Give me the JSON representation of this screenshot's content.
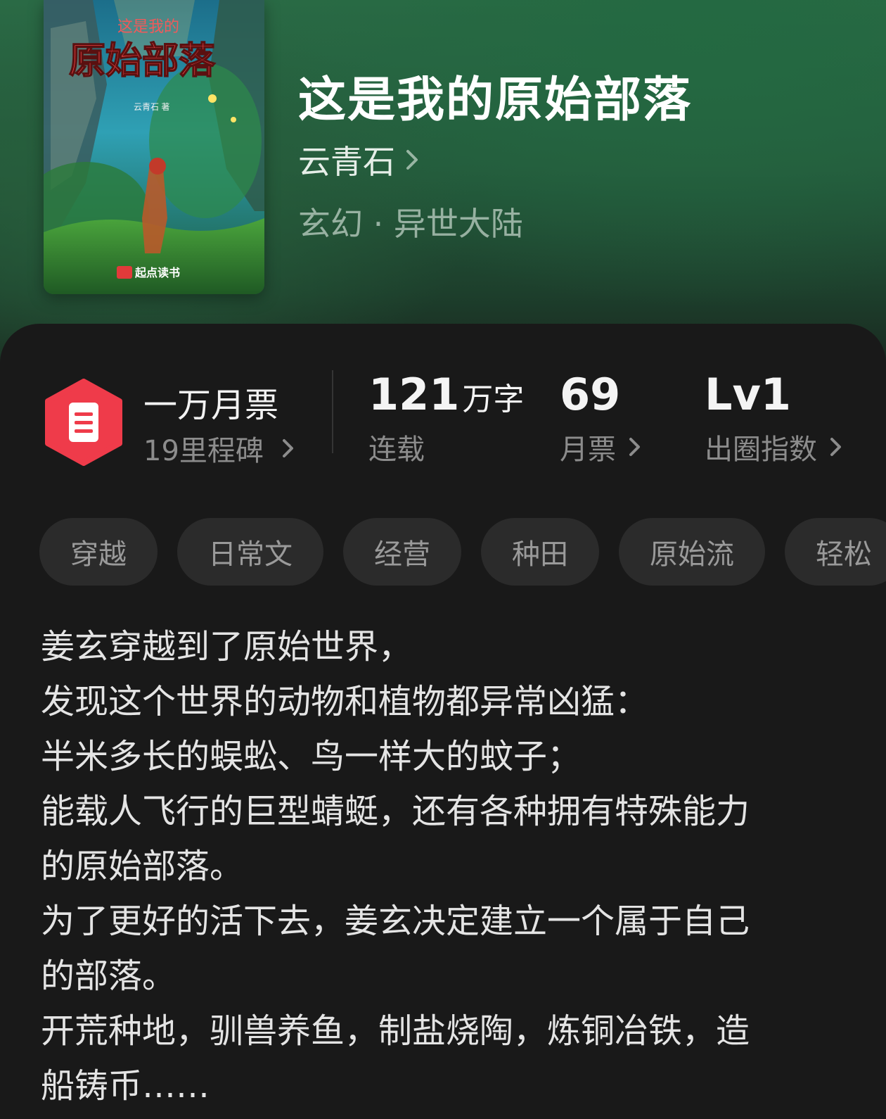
{
  "book": {
    "title": "这是我的原始部落",
    "author": "云青石",
    "genre": "玄幻 · 异世大陆",
    "cover": {
      "title_small": "这是我的",
      "title_large": "原始部落",
      "author": "云青石 著",
      "publisher": "起点读书"
    }
  },
  "stats": {
    "badge_title": "一万月票",
    "badge_sub": "19里程碑",
    "words_value": "121",
    "words_unit": "万字",
    "words_label": "连载",
    "tickets_value": "69",
    "tickets_label": "月票",
    "level_value": "Lv1",
    "level_label": "出圈指数"
  },
  "tags": [
    "穿越",
    "日常文",
    "经营",
    "种田",
    "原始流",
    "轻松"
  ],
  "description": [
    "姜玄穿越到了原始世界，",
    "发现这个世界的动物和植物都异常凶猛：",
    "半米多长的蜈蚣、鸟一样大的蚊子；",
    "能载人飞行的巨型蜻蜓，还有各种拥有特殊能力",
    "的原始部落。",
    "为了更好的活下去，姜玄决定建立一个属于自己",
    "的部落。",
    "开荒种地，驯兽养鱼，制盐烧陶，炼铜冶铁，造",
    "船铸币……"
  ],
  "colors": {
    "badge_red": "#ef3b4a",
    "header_green": "#2a6a45",
    "panel_bg": "#191919",
    "tag_bg": "#2b2b2b"
  }
}
